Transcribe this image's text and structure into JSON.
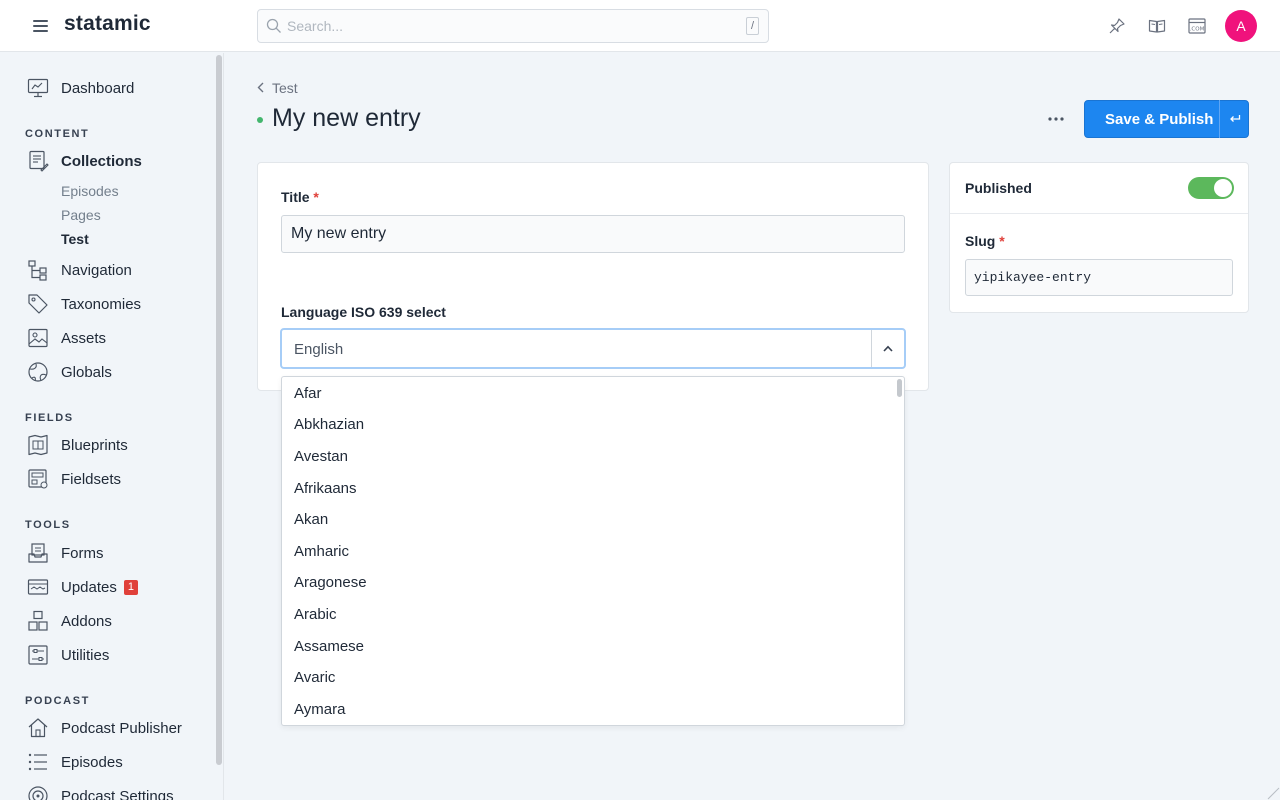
{
  "app": {
    "logo": "statamic"
  },
  "search": {
    "placeholder": "Search...",
    "shortcut": "/"
  },
  "user": {
    "initial": "A",
    "avatar_color": "#f0127c"
  },
  "sidebar": {
    "dashboard": "Dashboard",
    "sections": {
      "content": "CONTENT",
      "fields": "FIELDS",
      "tools": "TOOLS",
      "podcast": "PODCAST"
    },
    "collections": "Collections",
    "collection_children": [
      "Episodes",
      "Pages",
      "Test"
    ],
    "navigation": "Navigation",
    "taxonomies": "Taxonomies",
    "assets": "Assets",
    "globals": "Globals",
    "blueprints": "Blueprints",
    "fieldsets": "Fieldsets",
    "forms": "Forms",
    "updates": "Updates",
    "updates_badge": "1",
    "addons": "Addons",
    "utilities": "Utilities",
    "podcast_publisher": "Podcast Publisher",
    "episodes": "Episodes",
    "podcast_settings": "Podcast Settings"
  },
  "header": {
    "breadcrumb": "Test",
    "title": "My new entry",
    "save_label": "Save & Publish"
  },
  "form": {
    "title_label": "Title",
    "required_mark": "*",
    "title_value": "My new entry",
    "language_label": "Language ISO 639 select",
    "language_value": "English",
    "options": [
      "Afar",
      "Abkhazian",
      "Avestan",
      "Afrikaans",
      "Akan",
      "Amharic",
      "Aragonese",
      "Arabic",
      "Assamese",
      "Avaric",
      "Aymara"
    ]
  },
  "side": {
    "published_label": "Published",
    "published": true,
    "slug_label": "Slug",
    "slug_value": "yipikayee-entry"
  },
  "colors": {
    "accent": "#1d86f0",
    "published_green": "#5cb85c",
    "status_dot": "#43b66e",
    "required": "#e0403a"
  }
}
